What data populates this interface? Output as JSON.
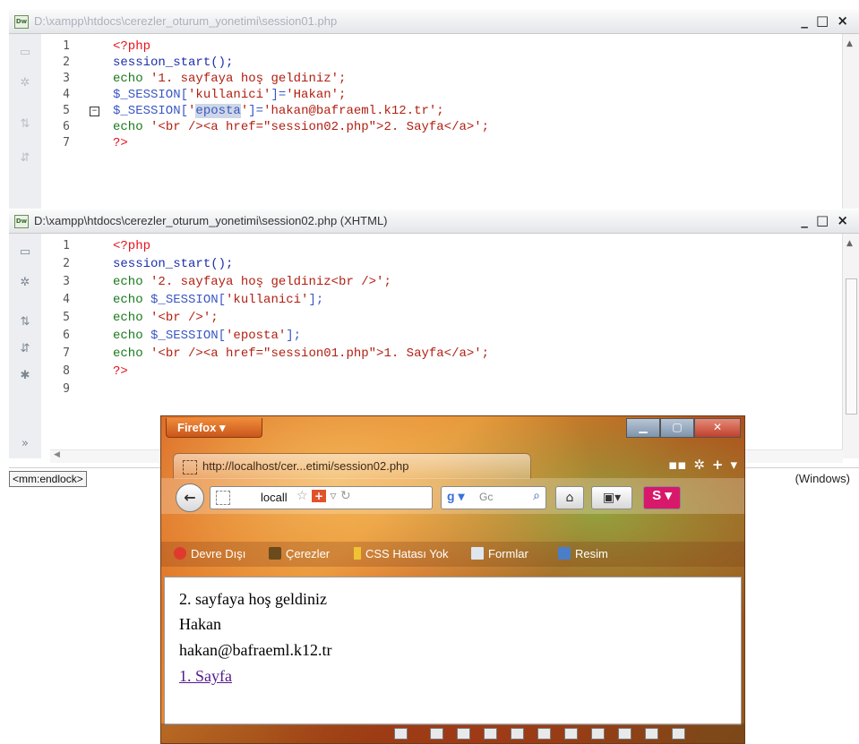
{
  "window1": {
    "title": "D:\\xampp\\htdocs\\cerezler_oturum_yonetimi\\session01.php",
    "controls": "_ □ ×",
    "lines": [
      "1",
      "2",
      "3",
      "4",
      "5",
      "6",
      "7"
    ],
    "code": {
      "l1": "<?php",
      "l2": "session_start();",
      "l3_kw": "echo ",
      "l3_str": "'1. sayfaya hoş geldiniz';",
      "l4_var": "$_SESSION[",
      "l4_key": "'kullanici'",
      "l4_rest": "]=",
      "l4_val": "'Hakan';",
      "l5_var": "$_SESSION[",
      "l5_q1": "'",
      "l5_sel": "eposta",
      "l5_q2": "'",
      "l5_rest": "]=",
      "l5_val": "'hakan@bafraeml.k12.tr';",
      "l6_kw": "echo ",
      "l6_str": "'<br /><a href=\"session02.php\">2. Sayfa</a>';",
      "l7": "?>"
    }
  },
  "window2": {
    "title": "D:\\xampp\\htdocs\\cerezler_oturum_yonetimi\\session02.php (XHTML)",
    "controls": "_ □ ×",
    "lines": [
      "1",
      "2",
      "3",
      "4",
      "5",
      "6",
      "7",
      "8",
      "9"
    ],
    "code": {
      "l1": "<?php",
      "l2": "session_start();",
      "l3_kw": "echo ",
      "l3_str": "'2. sayfaya hoş geldiniz<br />';",
      "l4_kw": "echo ",
      "l4_var": "$_SESSION[",
      "l4_key": "'kullanici'",
      "l4_rest": "];",
      "l5_kw": "echo ",
      "l5_str": "'<br />';",
      "l6_kw": "echo ",
      "l6_var": "$_SESSION[",
      "l6_key": "'eposta'",
      "l6_rest": "];",
      "l7_kw": "echo ",
      "l7_str": "'<br /><a href=\"session01.php\">1. Sayfa</a>';",
      "l8": "?>"
    },
    "status": {
      "tag_selector": "<mm:endlock>",
      "encoding": "(Windows)"
    }
  },
  "firefox": {
    "menu_button": "Firefox ▾",
    "tab_title": "http://localhost/cer...etimi/session02.php",
    "url_text": "locall",
    "search_placeholder": "Gc",
    "bookmarks": [
      "Devre Dışı",
      "Çerezler",
      "CSS Hatası Yok",
      "Formlar",
      "Resim"
    ],
    "page": {
      "line1": "2. sayfaya hoş geldiniz",
      "line2": "Hakan",
      "line3": "hakan@bafraeml.k12.tr",
      "link": "1. Sayfa"
    }
  }
}
